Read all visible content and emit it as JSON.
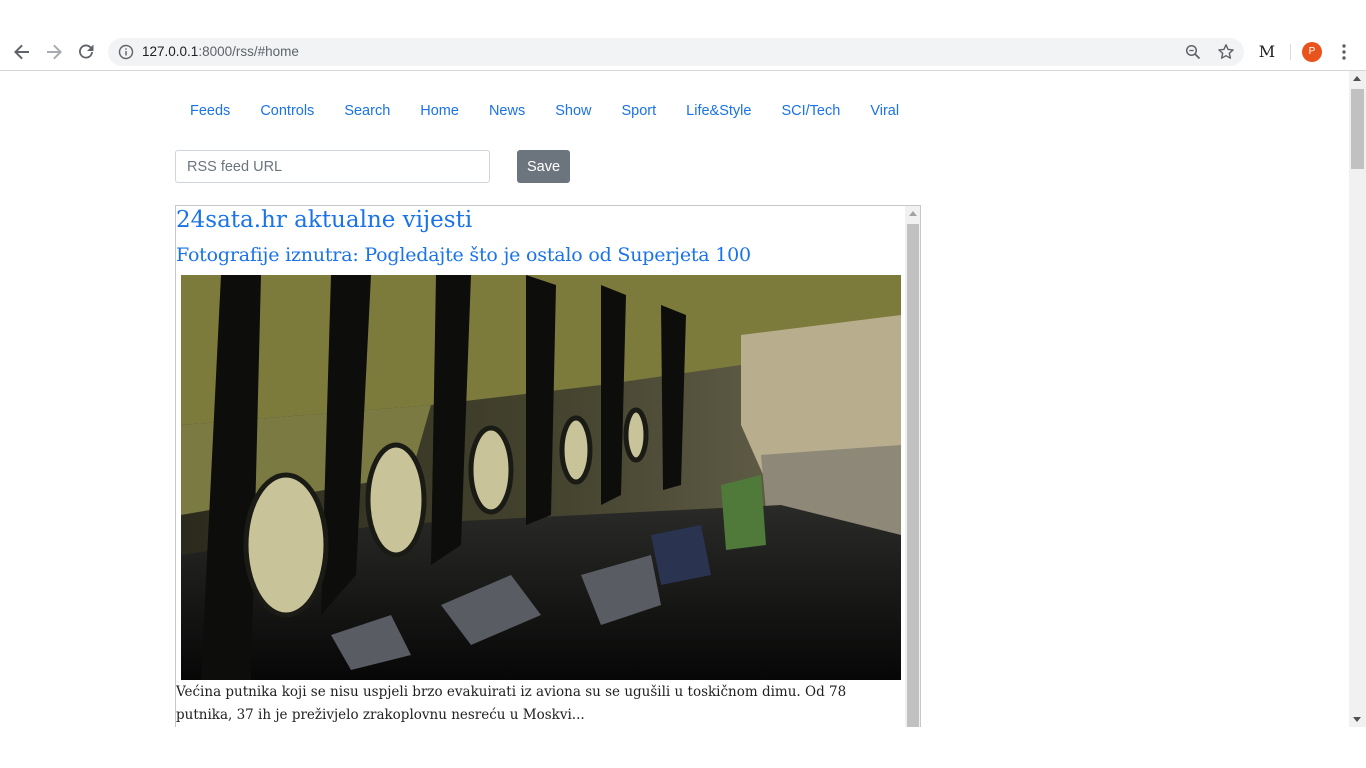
{
  "browser": {
    "url_host": "127.0.0.1",
    "url_rest": ":8000/rss/#home",
    "avatar_letter": "P",
    "extension_label": "M"
  },
  "nav": {
    "items": [
      "Feeds",
      "Controls",
      "Search",
      "Home",
      "News",
      "Show",
      "Sport",
      "Life&Style",
      "SCI/Tech",
      "Viral"
    ]
  },
  "form": {
    "placeholder": "RSS feed URL",
    "save_label": "Save"
  },
  "feed": {
    "title": "24sata.hr aktualne vijesti",
    "article": {
      "title": "Fotografije iznutra: Pogledajte što je ostalo od Superjeta 100",
      "description": "Većina putnika koji se nisu uspjeli brzo evakuirati iz aviona su se ugušili u toskičnom dimu. Od 78 putnika, 37 ih je preživjelo zrakoplovnu nesreću u Moskvi..."
    }
  },
  "colors": {
    "link": "#1a73e8",
    "button": "#6c757d",
    "avatar": "#e8541c"
  }
}
